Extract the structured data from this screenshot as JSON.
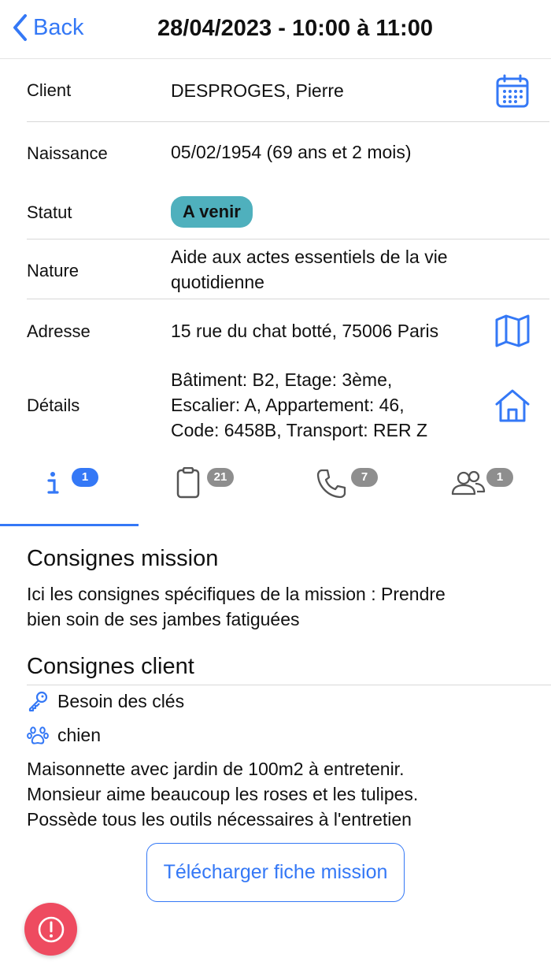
{
  "nav": {
    "back_label": "Back",
    "title": "28/04/2023 - 10:00 à 11:00"
  },
  "details": {
    "client": {
      "label": "Client",
      "value": "DESPROGES, Pierre"
    },
    "naissance": {
      "label": "Naissance",
      "value": "05/02/1954 (69 ans et 2 mois)"
    },
    "statut": {
      "label": "Statut",
      "value": "A venir",
      "color": "#4fb0bd"
    },
    "nature": {
      "label": "Nature",
      "value_line1": "Aide aux actes essentiels de la vie",
      "value_line2": "quotidienne"
    },
    "adresse": {
      "label": "Adresse",
      "value": "15 rue du chat botté, 75006 Paris"
    },
    "details_info": {
      "label": "Détails",
      "line1": "Bâtiment: B2, Etage: 3ème,",
      "line2": "Escalier: A, Appartement: 46,",
      "line3": "Code: 6458B, Transport: RER Z"
    }
  },
  "tabs": [
    {
      "icon": "info-icon",
      "count": "1",
      "active": true
    },
    {
      "icon": "clipboard-icon",
      "count": "21",
      "active": false
    },
    {
      "icon": "phone-icon",
      "count": "7",
      "active": false
    },
    {
      "icon": "users-icon",
      "count": "1",
      "active": false
    }
  ],
  "consignes_mission": {
    "title": "Consignes mission",
    "line1": "Ici les consignes spécifiques de la mission : Prendre",
    "line2": "bien soin de ses jambes fatiguées"
  },
  "consignes_client": {
    "title": "Consignes client",
    "key_text": "Besoin des clés",
    "pet_text": "chien",
    "line1": "Maisonnette avec jardin de 100m2 à entretenir.",
    "line2": "Monsieur aime beaucoup les roses et les tulipes.",
    "line3": "Possède tous les outils nécessaires à l'entretien"
  },
  "download_button": "Télécharger fiche mission",
  "colors": {
    "accent": "#3478f6",
    "status": "#4fb0bd",
    "alert": "#ee4b60",
    "badge_inactive": "#8e8e8e"
  }
}
